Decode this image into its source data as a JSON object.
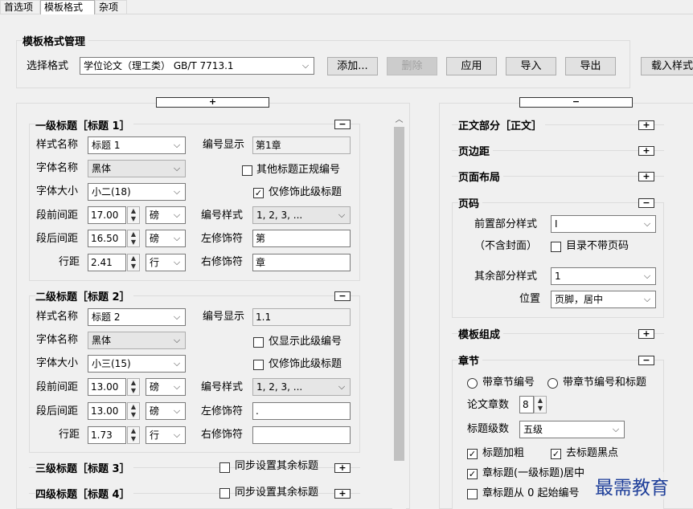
{
  "tabs": [
    "首选项",
    "模板格式",
    "杂项"
  ],
  "mgmt": {
    "title": "模板格式管理",
    "select_label": "选择格式",
    "select_value": "学位论文（理工类） GB/T 7713.1",
    "buttons": {
      "add": "添加...",
      "delete": "删除",
      "apply": "应用",
      "import": "导入",
      "export": "导出",
      "load": "载入样式"
    }
  },
  "left": {
    "expand_symbol": "+",
    "h1": {
      "title": "一级标题［标题 1］",
      "style_name_label": "样式名称",
      "style_name": "标题 1",
      "number_display_label": "编号显示",
      "number_display": "第1章",
      "font_name_label": "字体名称",
      "font_name": "黑体",
      "other_numbering": "其他标题正规编号",
      "font_size_label": "字体大小",
      "font_size": "小二(18)",
      "only_decorate": "仅修饰此级标题",
      "space_before_label": "段前间距",
      "space_before": "17.00",
      "unit1": "磅",
      "number_style_label": "编号样式",
      "number_style": "1, 2, 3, ...",
      "space_after_label": "段后间距",
      "space_after": "16.50",
      "unit2": "磅",
      "left_deco_label": "左修饰符",
      "left_deco": "第",
      "line_spacing_label": "行距",
      "line_spacing": "2.41",
      "unit3": "行",
      "right_deco_label": "右修饰符",
      "right_deco": "章"
    },
    "h2": {
      "title": "二级标题［标题 2］",
      "style_name_label": "样式名称",
      "style_name": "标题 2",
      "number_display_label": "编号显示",
      "number_display": "1.1",
      "font_name_label": "字体名称",
      "font_name": "黑体",
      "only_show_level": "仅显示此级编号",
      "font_size_label": "字体大小",
      "font_size": "小三(15)",
      "only_decorate": "仅修饰此级标题",
      "space_before_label": "段前间距",
      "space_before": "13.00",
      "unit1": "磅",
      "number_style_label": "编号样式",
      "number_style": "1, 2, 3, ...",
      "space_after_label": "段后间距",
      "space_after": "13.00",
      "unit2": "磅",
      "left_deco_label": "左修饰符",
      "left_deco": ".",
      "line_spacing_label": "行距",
      "line_spacing": "1.73",
      "unit3": "行",
      "right_deco_label": "右修饰符",
      "right_deco": ""
    },
    "h3": {
      "title": "三级标题［标题 3］",
      "sync": "同步设置其余标题"
    },
    "h4": {
      "title": "四级标题［标题 4］",
      "sync": "同步设置其余标题"
    }
  },
  "right": {
    "collapse_symbol": "−",
    "body_section": "正文部分［正文］",
    "margins": "页边距",
    "layout": "页面布局",
    "page_num": {
      "title": "页码",
      "front_label": "前置部分样式",
      "front_value": "I",
      "no_cover": "（不含封面）",
      "toc_no_num": "目录不带页码",
      "rest_label": "其余部分样式",
      "rest_value": "1",
      "pos_label": "位置",
      "pos_value": "页脚，居中"
    },
    "template": "模板组成",
    "chapter": {
      "title": "章节",
      "radio1": "带章节编号",
      "radio2": "带章节编号和标题",
      "count_label": "论文章数",
      "count": "8",
      "level_label": "标题级数",
      "level": "五级",
      "bold": "标题加粗",
      "no_dot": "去标题黑点",
      "center": "章标题(一级标题)居中",
      "from_zero": "章标题从 0 起始编号"
    }
  },
  "watermark": "最需教育"
}
